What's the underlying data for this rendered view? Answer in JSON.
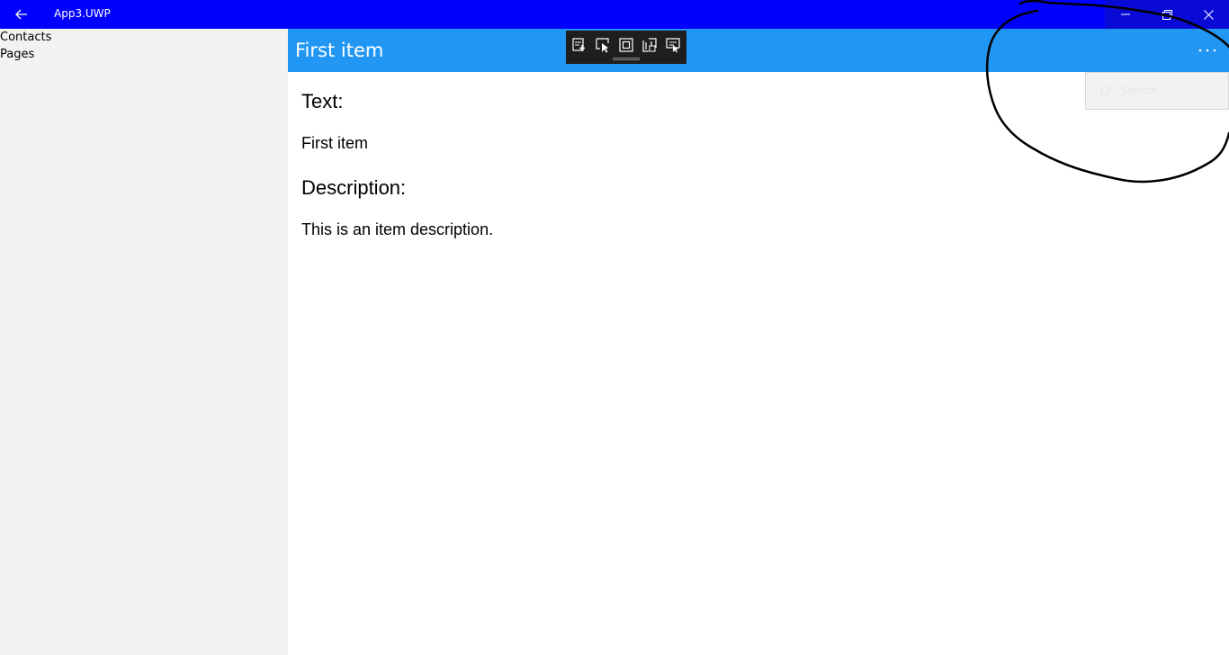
{
  "window": {
    "title": "App3.UWP",
    "back_icon": "arrow-left-icon",
    "minimize_icon": "minimize-icon",
    "restore_icon": "restore-icon",
    "close_icon": "close-icon",
    "titlebar_color": "#0000ff"
  },
  "sidebar": {
    "items": [
      {
        "label": "Contacts"
      },
      {
        "label": "Pages"
      }
    ]
  },
  "header": {
    "title": "First item",
    "more_icon": "more-ellipsis-icon",
    "color": "#2196f3"
  },
  "debug_toolbar": {
    "icons": [
      "go-to-live-visual-tree-icon",
      "select-element-icon",
      "display-layout-adorners-icon",
      "track-focus-icon",
      "preview-selection-icon"
    ]
  },
  "search": {
    "placeholder": "Search",
    "icon": "search-icon"
  },
  "content": {
    "text_label": "Text:",
    "text_value": "First item",
    "description_label": "Description:",
    "description_value": "This is an item description."
  }
}
